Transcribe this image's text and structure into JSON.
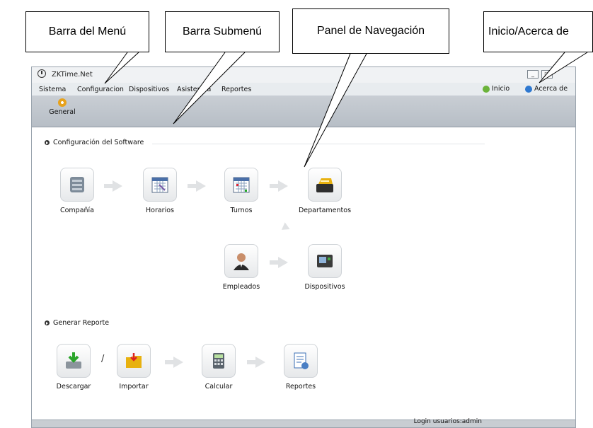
{
  "callouts": {
    "menu_bar": "Barra del Menú",
    "submenu_bar": "Barra Submenú",
    "nav_panel": "Panel de Navegación",
    "home_about": "Inicio/Acerca de"
  },
  "window": {
    "title": "ZKTime.Net",
    "controls": [
      "_",
      "□"
    ]
  },
  "menu": {
    "items": [
      "Sistema",
      "Configuracion",
      "Dispositivos",
      "Asistencia",
      "Reportes"
    ],
    "home_label": "Inicio",
    "about_label": "Acerca de"
  },
  "submenu": {
    "general_label": "General"
  },
  "sections": {
    "software_config": "Configuración del Software",
    "generate_report": "Generar Reporte"
  },
  "nav_items": {
    "company": "Compañía",
    "schedules": "Horarios",
    "shifts": "Turnos",
    "departments": "Departamentos",
    "employees": "Empleados",
    "devices": "Dispositivos",
    "download": "Descargar",
    "import": "Importar",
    "calculate": "Calcular",
    "reports": "Reportes"
  },
  "import_separator": "/",
  "status": {
    "login_text": "Login usuarios:admin"
  },
  "colors": {
    "home_icon": "#6bb33a",
    "about_icon": "#2e78d0",
    "gear_icon": "#e7a21c"
  }
}
